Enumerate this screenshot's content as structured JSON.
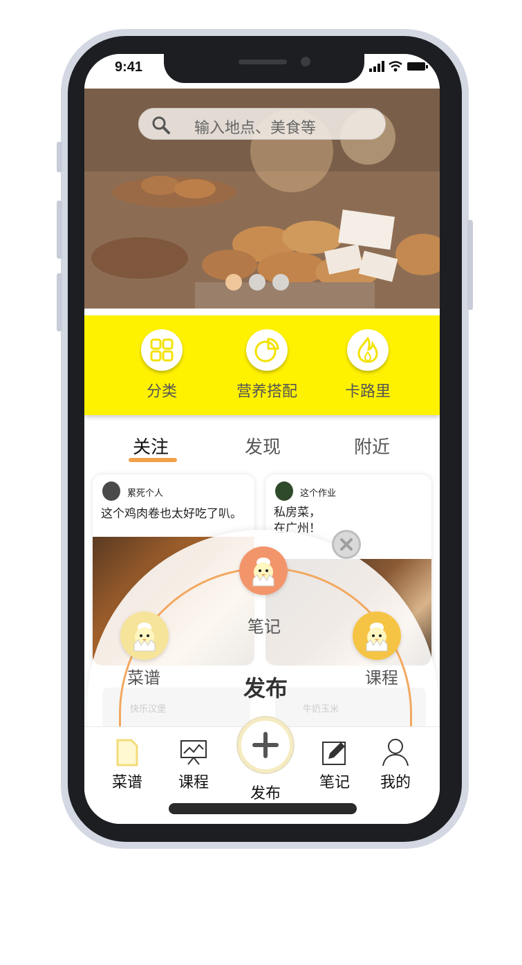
{
  "status": {
    "time": "9:41"
  },
  "search": {
    "placeholder": "输入地点、美食等"
  },
  "banner": {
    "dots": 3,
    "active_dot": 0
  },
  "quick_menu": [
    {
      "label": "分类",
      "icon": "grid-icon"
    },
    {
      "label": "营养搭配",
      "icon": "pie-chart-icon"
    },
    {
      "label": "卡路里",
      "icon": "flame-icon"
    }
  ],
  "tabs": [
    {
      "label": "关注",
      "active": true
    },
    {
      "label": "发现",
      "active": false
    },
    {
      "label": "附近",
      "active": false
    }
  ],
  "feed": [
    {
      "user": "累死个人",
      "text": "这个鸡肉卷也太好吃了叭。"
    },
    {
      "user": "这个作业",
      "text_line1": "私房菜，",
      "text_line2": "在广州！"
    }
  ],
  "faded_cards": [
    {
      "user": "快乐汉堡"
    },
    {
      "user": "牛奶玉米"
    }
  ],
  "publish_menu": {
    "title": "发布",
    "options": [
      {
        "label": "笔记",
        "icon": "chick-chef-icon",
        "color": "#f3956a"
      },
      {
        "label": "菜谱",
        "icon": "chick-chef-icon",
        "color": "#f6e49a"
      },
      {
        "label": "课程",
        "icon": "chick-chef-icon",
        "color": "#f6c445"
      }
    ],
    "close_icon": "close-icon"
  },
  "bottom_nav": {
    "items": [
      {
        "label": "菜谱",
        "icon": "document-icon"
      },
      {
        "label": "课程",
        "icon": "presentation-icon"
      },
      {
        "label": "发布",
        "icon": "plus-icon"
      },
      {
        "label": "笔记",
        "icon": "edit-icon"
      },
      {
        "label": "我的",
        "icon": "user-icon"
      }
    ]
  },
  "colors": {
    "accent_yellow": "#fff200",
    "accent_orange": "#f0a048",
    "frame": "#1d1e22"
  }
}
